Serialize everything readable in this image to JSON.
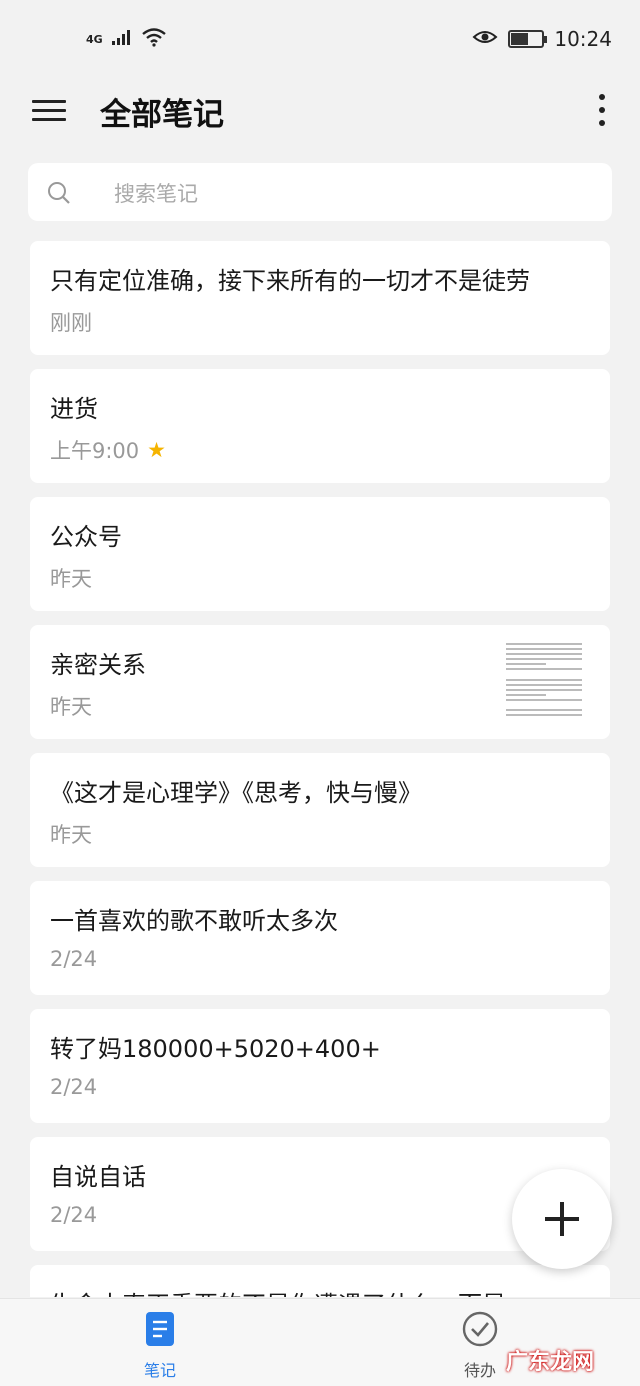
{
  "status_bar": {
    "network": "4G",
    "time": "10:24",
    "battery_level": 0.55
  },
  "app_bar": {
    "title": "全部笔记",
    "menu_icon": "hamburger-menu-icon",
    "more_icon": "more-vertical-icon"
  },
  "search": {
    "placeholder": "搜索笔记",
    "icon": "search-icon"
  },
  "notes": [
    {
      "title": "只有定位准确，接下来所有的一切才不是徒劳",
      "meta": "刚刚",
      "starred": false,
      "has_thumbnail": false
    },
    {
      "title": "进货",
      "meta": "上午9:00",
      "starred": true,
      "has_thumbnail": false
    },
    {
      "title": "公众号",
      "meta": "昨天",
      "starred": false,
      "has_thumbnail": false
    },
    {
      "title": "亲密关系",
      "meta": "昨天",
      "starred": false,
      "has_thumbnail": true
    },
    {
      "title": "《这才是心理学》《思考，快与慢》",
      "meta": "昨天",
      "starred": false,
      "has_thumbnail": false
    },
    {
      "title": "一首喜欢的歌不敢听太多次",
      "meta": "2/24",
      "starred": false,
      "has_thumbnail": false
    },
    {
      "title": "转了妈180000+5020+400+",
      "meta": "2/24",
      "starred": false,
      "has_thumbnail": false
    },
    {
      "title": "自说自话",
      "meta": "2/24",
      "starred": false,
      "has_thumbnail": false
    },
    {
      "title": "生命中真正重要的不是你遭遇了什么，而是",
      "meta": "",
      "starred": false,
      "has_thumbnail": false
    }
  ],
  "fab": {
    "icon": "plus-icon"
  },
  "bottom_nav": {
    "notes_label": "笔记",
    "todo_label": "待办",
    "active_color": "#2a7ee8"
  },
  "watermark": "广东龙网"
}
